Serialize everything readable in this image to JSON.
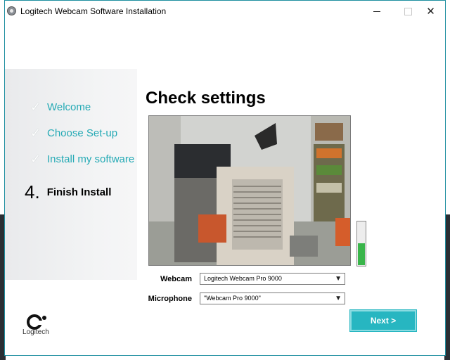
{
  "window": {
    "title": "Logitech Webcam Software Installation"
  },
  "steps": [
    {
      "label": "Welcome",
      "state": "done"
    },
    {
      "label": "Choose Set-up",
      "state": "done"
    },
    {
      "label": "Install my software",
      "state": "done"
    }
  ],
  "active_step": {
    "number": "4.",
    "label": "Finish Install"
  },
  "heading": "Check settings",
  "preview": {
    "mic_level_fraction": 0.5
  },
  "webcam": {
    "label": "Webcam",
    "selected": "Logitech Webcam Pro 9000"
  },
  "microphone": {
    "label": "Microphone",
    "selected": "\"Webcam Pro 9000\""
  },
  "brand": {
    "name": "Logitech"
  },
  "next_button": {
    "label": "Next >"
  },
  "colors": {
    "accent": "#27b6c1",
    "step_done": "#25aab5",
    "level": "#39b54a"
  },
  "icons": {
    "check": "check-icon",
    "dropdown": "chevron-down-icon",
    "close": "close-icon"
  }
}
